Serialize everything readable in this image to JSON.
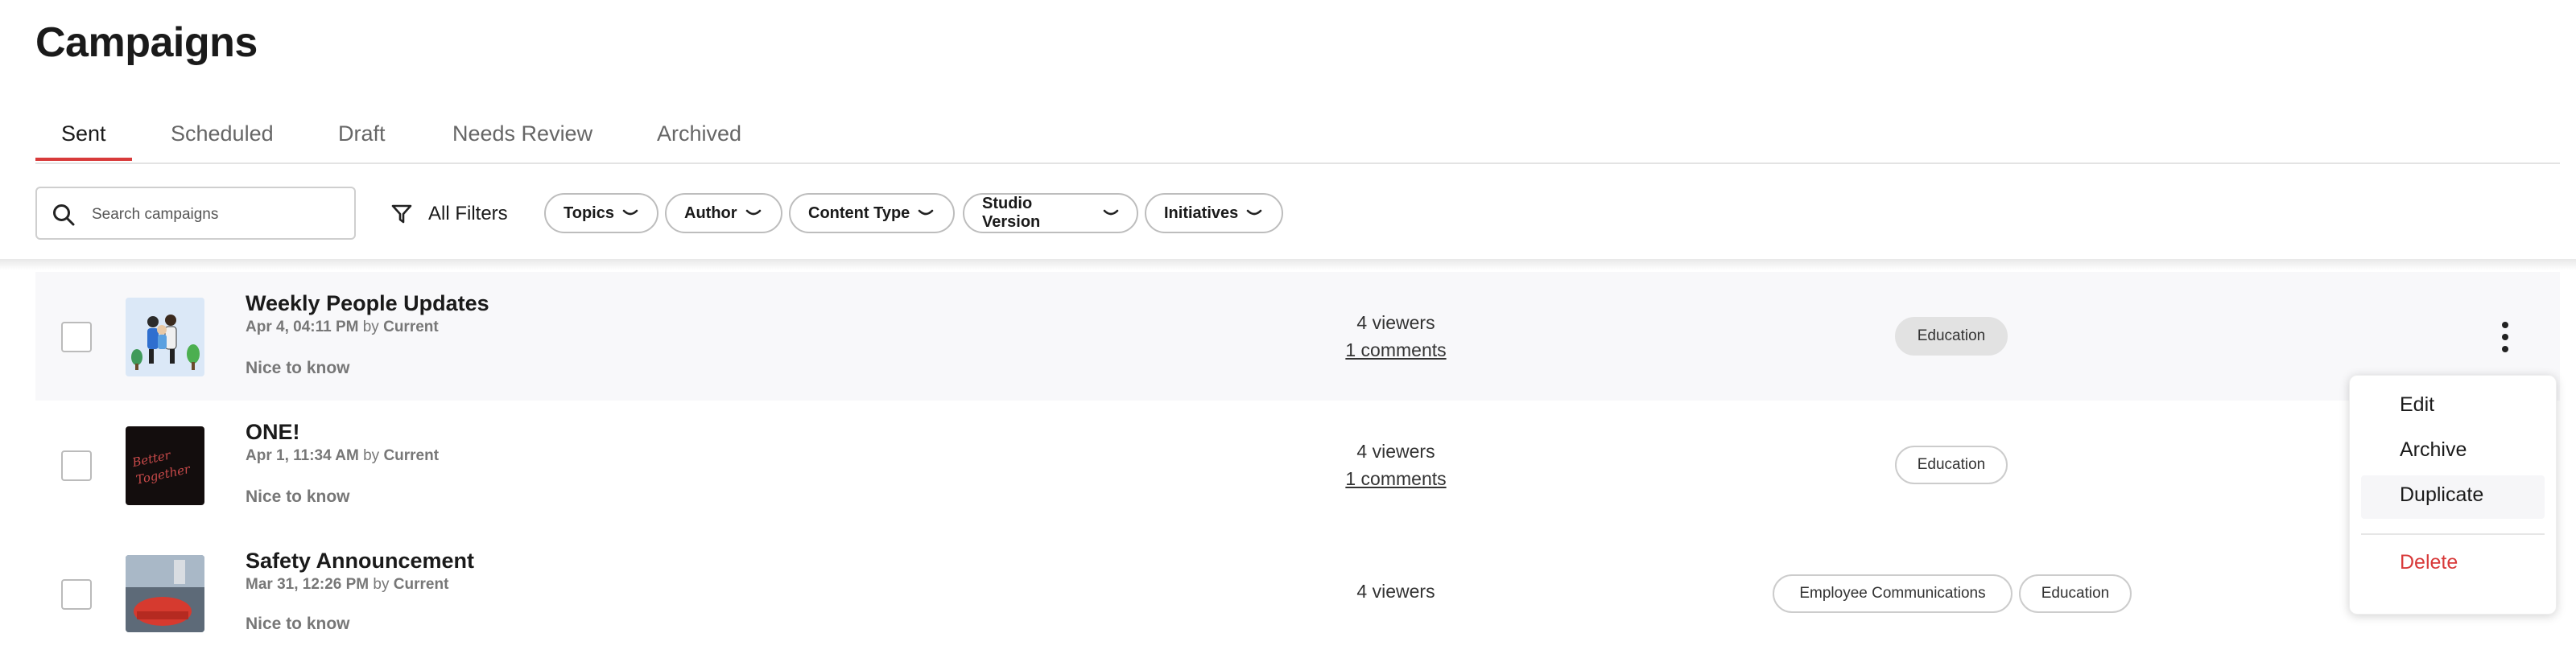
{
  "page": {
    "title": "Campaigns"
  },
  "tabs": [
    {
      "label": "Sent",
      "active": true
    },
    {
      "label": "Scheduled"
    },
    {
      "label": "Draft"
    },
    {
      "label": "Needs Review"
    },
    {
      "label": "Archived"
    }
  ],
  "accent_color": "#d83a3a",
  "search": {
    "placeholder": "Search campaigns",
    "value": "",
    "icon": "search-icon"
  },
  "all_filters": {
    "label": "All Filters",
    "icon": "filter-icon"
  },
  "filter_chips": [
    {
      "label": "Topics"
    },
    {
      "label": "Author"
    },
    {
      "label": "Content Type"
    },
    {
      "label": "Studio Version"
    },
    {
      "label": "Initiatives"
    }
  ],
  "campaigns": [
    {
      "title": "Weekly People Updates",
      "date": "Apr 4, 04:11 PM",
      "by_word": "by",
      "author": "Current",
      "priority": "Nice to know",
      "viewers": "4 viewers",
      "comments": "1 comments",
      "tags": [
        "Education"
      ],
      "highlighted": true
    },
    {
      "title": "ONE!",
      "date": "Apr 1, 11:34 AM",
      "by_word": "by",
      "author": "Current",
      "priority": "Nice to know",
      "viewers": "4 viewers",
      "comments": "1 comments",
      "tags": [
        "Education"
      ],
      "thumb_text": "Better Together"
    },
    {
      "title": "Safety Announcement",
      "date": "Mar 31, 12:26 PM",
      "by_word": "by",
      "author": "Current",
      "priority": "Nice to know",
      "viewers": "4 viewers",
      "tags": [
        "Employee Communications",
        "Education"
      ]
    }
  ],
  "row_menu": {
    "items": [
      {
        "label": "Edit"
      },
      {
        "label": "Archive"
      },
      {
        "label": "Duplicate",
        "hovered": true
      },
      {
        "label": "Delete",
        "danger": true
      }
    ]
  }
}
